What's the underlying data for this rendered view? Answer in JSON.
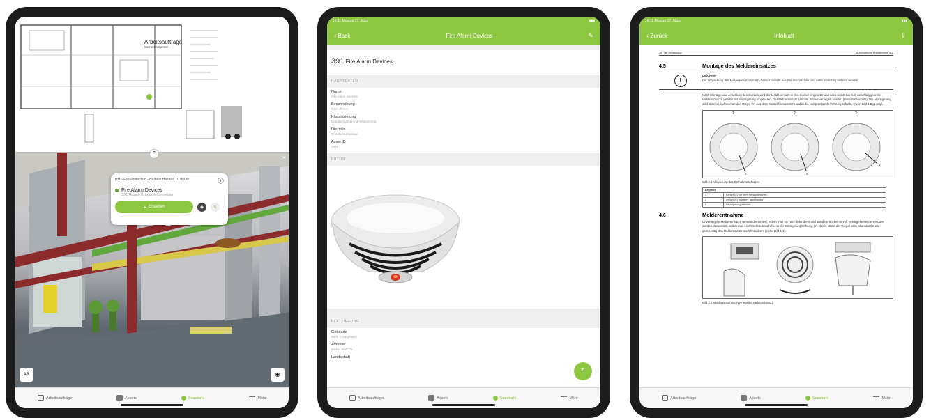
{
  "tablet1": {
    "plan_title": "Arbeitsaufträge",
    "plan_subtitle": "Meine Endgeräte",
    "popup_header": "BMS Fire Protection - Haltabe Haltabe 1078938",
    "popup_title": "Fire Alarm Devices",
    "popup_subtitle": "391 Rauch Brandmeldemelder",
    "popup_button": "Erstellen",
    "view_badge": "AR",
    "tabs": [
      "Arbeitsaufträge",
      "Assets",
      "Standorte",
      "Mehr"
    ],
    "active_tab": 2
  },
  "tablet2": {
    "status_time": "16:11 Montag 17. März",
    "nav_back": "Back",
    "nav_title": "Fire Alarm Devices",
    "heading_number": "391",
    "heading_text": "Fire Alarm Devices",
    "section_main": "HAUPTDATEN",
    "fields": [
      {
        "label": "Name",
        "value": "Fire Alarm Devices"
      },
      {
        "label": "Beschreibung",
        "value": "Ihrer offener"
      },
      {
        "label": "Klassifizierung",
        "value": "Brandschutz Brandmeldetechnik"
      },
      {
        "label": "Disziplin",
        "value": "Brandschutzanlage"
      },
      {
        "label": "Asset ID",
        "value": "1645"
      }
    ],
    "section_photo": "FOTOS",
    "section_location": "PLATZIERUNG",
    "location_fields": [
      {
        "label": "Gebäude",
        "value": "Werk 5 Hauptwerk"
      },
      {
        "label": "Adresse",
        "value": "Michel Walz 25"
      },
      {
        "label": "Landschaft",
        "value": ""
      }
    ],
    "tabs": [
      "Arbeitsaufträge",
      "Assets",
      "Standorte",
      "Mehr"
    ],
    "active_tab": 2
  },
  "tablet3": {
    "status_time": "16:11 Montag 17. März",
    "nav_back": "Zurück",
    "nav_title": "Infoblatt",
    "doc_header_left": "26 | de | Installation",
    "doc_header_right": "Automatische Brandmelder 4LT",
    "s45_number": "4.5",
    "s45_title": "Montage des Meldereinsatzes",
    "hint_label": "HINWEIS!",
    "hint_text": "Die Verpackung des Meldereinsatzes mit C-Sensor besteht aus Staubschutzfolie und sollte vorsichtig entfernt werden.",
    "para1": "Nach Montage und Anschluss des Sockels wird der Meldereinsatz in den Sockel eingesetzt und nach rechts bis zum Anschlag gedreht. Meldereinsätze werden mit Verriegelung eingeliefert. Der Meldereinsatz kann im Sockel verriegelt werden (Entnahmeschutz). Die Verriegelung wird aktiviert, indem man den Riegel (X) aus dem Sockel herausbricht und in die entsprechende Führung schiebt, wie in Bild 4.2 gezeigt.",
    "figure_numbers": [
      "1",
      "2",
      "3"
    ],
    "figure1_caption": "Bild 4.1   Aktivierung des Entnahmeschutzes",
    "legend_title": "Legende",
    "legend_rows": [
      [
        "1",
        "Riegel (X) vor dem Herausbrechen"
      ],
      [
        "2",
        "Riegel (X) montiert, aber inaktiv"
      ],
      [
        "3",
        "Verriegelung aktiviert"
      ]
    ],
    "s46_number": "4.6",
    "s46_title": "Melderentnahme",
    "para2": "Unverriegelte Meldereinsätze werden demontiert, indem man sie nach links dreht und aus dem Sockel nimmt. Verriegelte Meldereinsätze werden demontiert, indem man einen Schraubendreher in die Entriegelungsöffnung (Y) steckt, damit der Riegel nach oben drückt und gleichzeitig den Meldereinsatz nach links dreht (siehe Bild 4.3).",
    "figure2_caption": "Bild 4.2   Melderentnahme (verriegelter Meldereinsatz)",
    "tabs": [
      "Arbeitsaufträge",
      "Assets",
      "Standorte",
      "Mehr"
    ],
    "active_tab": 2
  },
  "colors": {
    "accent": "#8dc63f",
    "bezel": "#1c1c1c"
  }
}
